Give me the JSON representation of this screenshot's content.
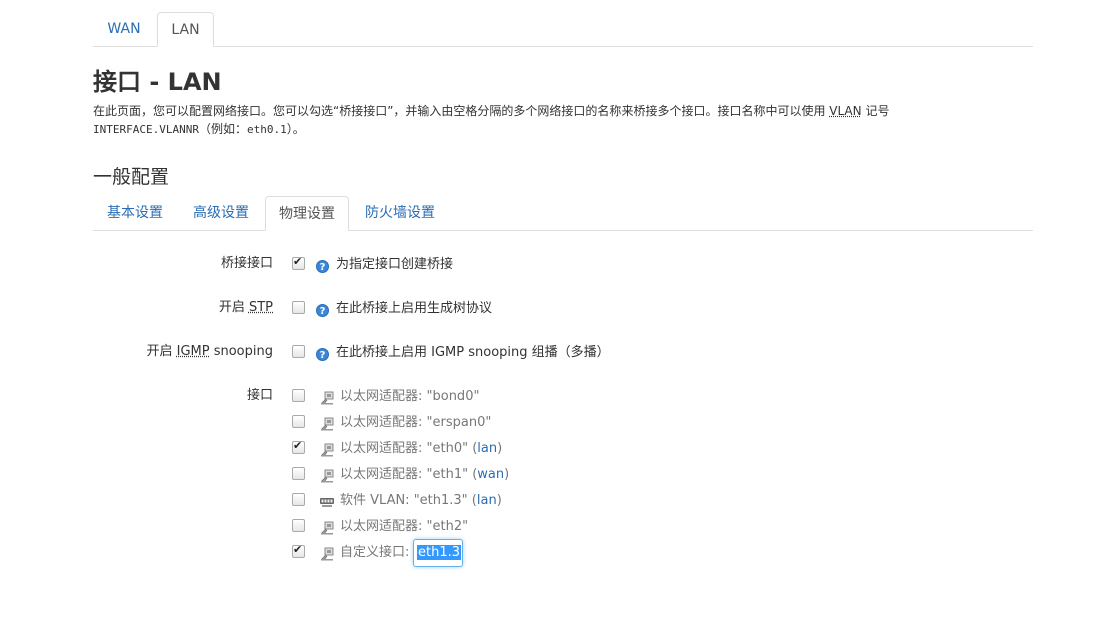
{
  "top_tabs": [
    {
      "label": "WAN",
      "active": false
    },
    {
      "label": "LAN",
      "active": true
    }
  ],
  "page": {
    "title": "接口 - LAN",
    "desc_line1_a": "在此页面，您可以配置网络接口。您可以勾选“桥接接口”，并输入由空格分隔的多个网络接口的名称来桥接多个接口。接口名称中可以使用 ",
    "desc_line1_abbr": "VLAN",
    "desc_line1_b": " 记号",
    "desc_line2_mono": "INTERFACE.VLANNR",
    "desc_line2_rest": "（例如：",
    "desc_line2_mono2": "eth0.1",
    "desc_line2_end": "）。"
  },
  "section": {
    "title": "一般配置",
    "tabs": [
      {
        "label": "基本设置",
        "active": false
      },
      {
        "label": "高级设置",
        "active": false
      },
      {
        "label": "物理设置",
        "active": true
      },
      {
        "label": "防火墙设置",
        "active": false
      }
    ]
  },
  "fields": {
    "bridge": {
      "label": "桥接接口",
      "checked": true,
      "help": "为指定接口创建桥接"
    },
    "stp": {
      "label_prefix": "开启 ",
      "label_abbr": "STP",
      "checked": false,
      "help": "在此桥接上启用生成树协议"
    },
    "igmp": {
      "label_prefix": "开启 ",
      "label_abbr": "IGMP",
      "label_suffix": " snooping",
      "checked": false,
      "help": "在此桥接上启用 IGMP snooping 组播（多播）"
    },
    "interfaces": {
      "label": "接口",
      "items": [
        {
          "text": "以太网适配器: \"bond0\"",
          "zone": "",
          "checked": false,
          "icon": "ethernet-icon"
        },
        {
          "text": "以太网适配器: \"erspan0\"",
          "zone": "",
          "checked": false,
          "icon": "ethernet-icon"
        },
        {
          "text": "以太网适配器: \"eth0\" (",
          "zone": "lan",
          "checked": true,
          "icon": "ethernet-icon"
        },
        {
          "text": "以太网适配器: \"eth1\" (",
          "zone": "wan",
          "checked": false,
          "icon": "ethernet-icon"
        },
        {
          "text": "软件 VLAN: \"eth1.3\" (",
          "zone": "lan",
          "checked": false,
          "icon": "vlan-icon"
        },
        {
          "text": "以太网适配器: \"eth2\"",
          "zone": "",
          "checked": false,
          "icon": "ethernet-icon"
        }
      ],
      "custom_label": "自定义接口:",
      "custom_value": "eth1.3",
      "custom_checked": true
    }
  },
  "colors": {
    "link": "#2a6db4",
    "help_icon": "#3b86d8"
  }
}
